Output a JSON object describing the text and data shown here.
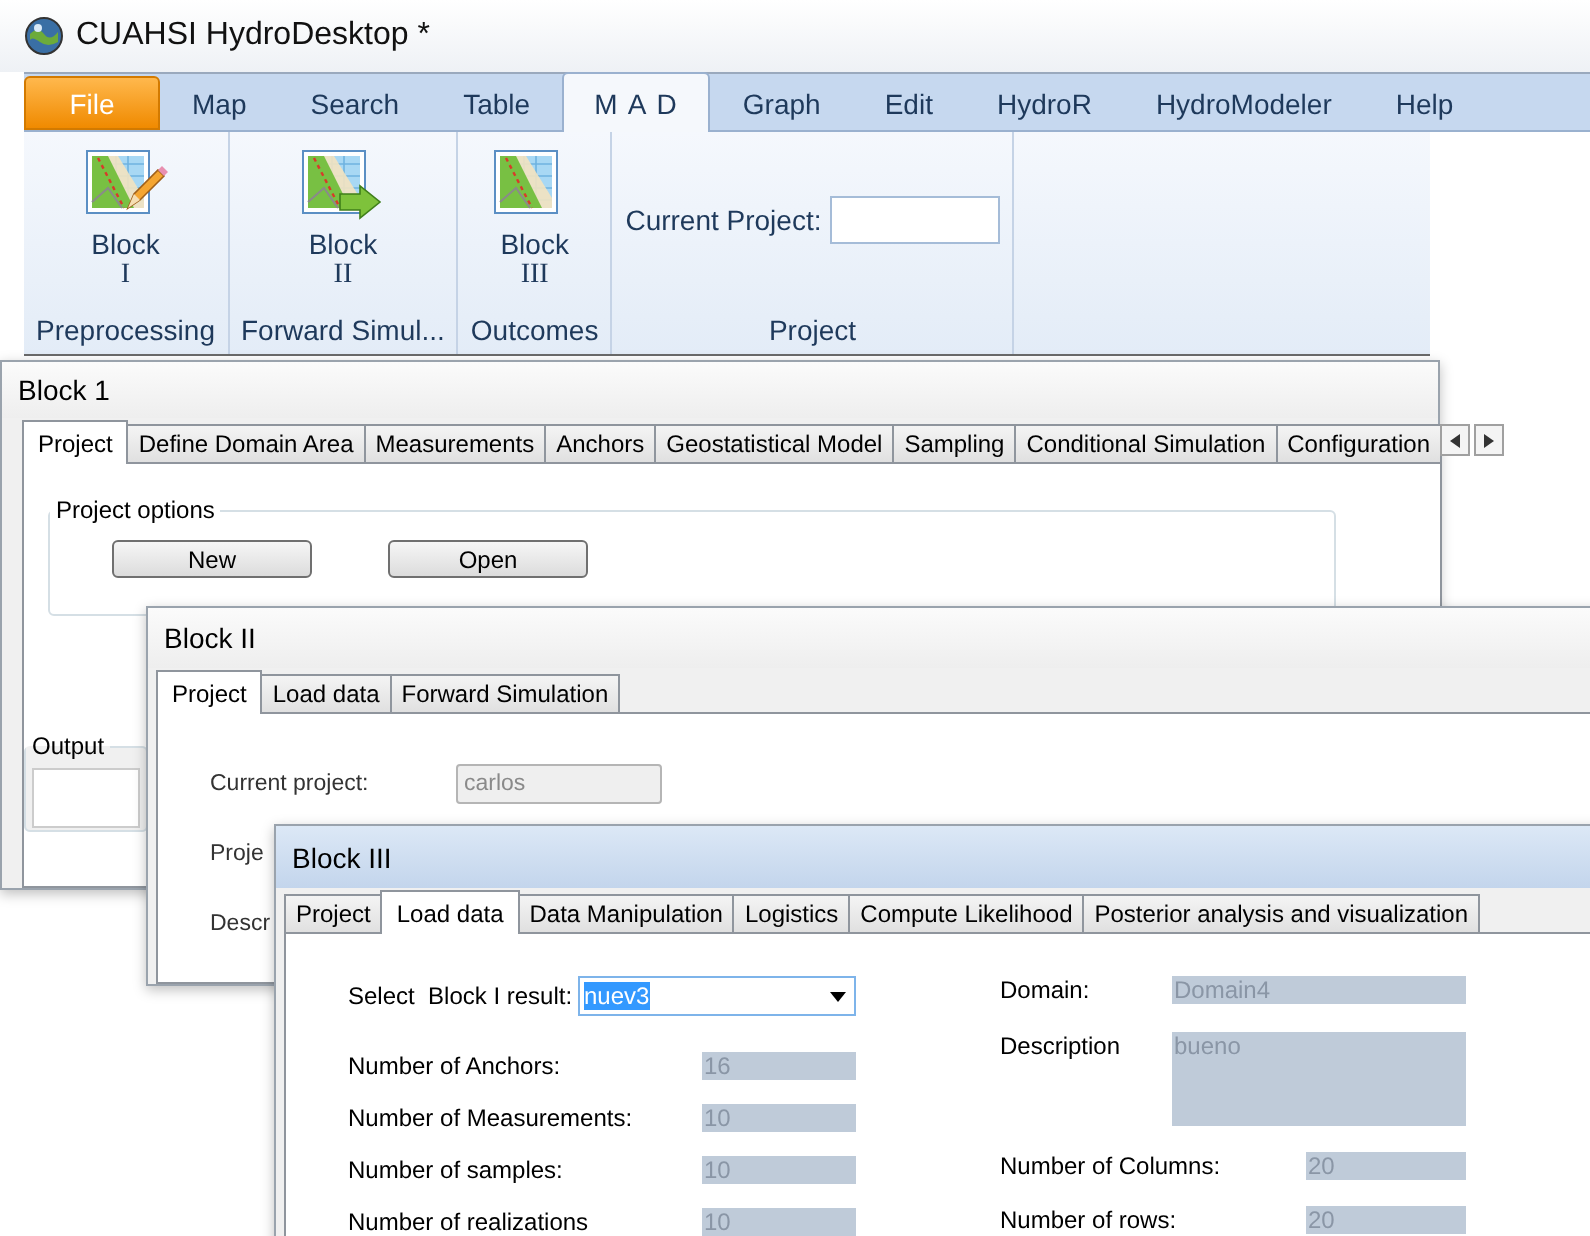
{
  "app": {
    "title": "CUAHSI HydroDesktop *"
  },
  "ribbon": {
    "tabs": [
      {
        "label": "File",
        "kind": "file",
        "selected": false
      },
      {
        "label": "Map",
        "kind": "tab",
        "selected": false
      },
      {
        "label": "Search",
        "kind": "tab",
        "selected": false
      },
      {
        "label": "Table",
        "kind": "tab",
        "selected": false
      },
      {
        "label": "M A D",
        "kind": "tab",
        "selected": true
      },
      {
        "label": "Graph",
        "kind": "tab",
        "selected": false
      },
      {
        "label": "Edit",
        "kind": "tab",
        "selected": false
      },
      {
        "label": "HydroR",
        "kind": "tab",
        "selected": false
      },
      {
        "label": "HydroModeler",
        "kind": "tab",
        "selected": false
      },
      {
        "label": "Help",
        "kind": "tab",
        "selected": false
      }
    ],
    "groups": [
      {
        "label": "Preprocessing",
        "kind": "buttons",
        "buttons": [
          {
            "label": "Block",
            "numeral": "I",
            "kind": "pencil"
          }
        ]
      },
      {
        "label": "Forward Simul...",
        "kind": "buttons",
        "buttons": [
          {
            "label": "Block",
            "numeral": "II",
            "kind": "arrow"
          }
        ]
      },
      {
        "label": "Outcomes",
        "kind": "buttons",
        "buttons": [
          {
            "label": "Block",
            "numeral": "III",
            "kind": "plain"
          }
        ]
      },
      {
        "label": "Project",
        "kind": "field",
        "field": {
          "label": "Current Project:"
        }
      }
    ]
  },
  "windows": [
    {
      "title": "Block 1",
      "active": false,
      "tabs": [
        {
          "label": "Project",
          "selected": true
        },
        {
          "label": "Define Domain Area",
          "selected": false
        },
        {
          "label": "Measurements",
          "selected": false
        },
        {
          "label": "Anchors",
          "selected": false
        },
        {
          "label": "Geostatistical Model",
          "selected": false
        },
        {
          "label": "Sampling",
          "selected": false
        },
        {
          "label": "Conditional Simulation",
          "selected": false
        },
        {
          "label": "Configuration",
          "selected": false
        }
      ],
      "content": {
        "kind": "project_options",
        "group": "Project options",
        "buttons": [
          "New",
          "Open"
        ],
        "output": "Output"
      }
    },
    {
      "title": "Block II",
      "active": false,
      "tabs": [
        {
          "label": "Project",
          "selected": true
        },
        {
          "label": "Load data",
          "selected": false
        },
        {
          "label": "Forward Simulation",
          "selected": false
        }
      ],
      "content": {
        "kind": "project",
        "fields": [
          {
            "label": "Current project:",
            "value": "carlos"
          },
          {
            "label": "Proje"
          },
          {
            "label": "Descr"
          }
        ]
      }
    },
    {
      "title": "Block III",
      "active": true,
      "tabs": [
        {
          "label": "Project",
          "selected": false
        },
        {
          "label": "Load data",
          "selected": true
        },
        {
          "label": "Data Manipulation",
          "selected": false
        },
        {
          "label": "Logistics",
          "selected": false
        },
        {
          "label": "Compute Likelihood",
          "selected": false
        },
        {
          "label": "Posterior analysis and visualization",
          "selected": false
        }
      ],
      "content": {
        "kind": "load_data",
        "select": {
          "label": "Select  Block I result:",
          "value": "nuev3",
          "highlighted": true
        },
        "left": [
          {
            "label": "Number of Anchors:",
            "value": "16"
          },
          {
            "label": "Number of Measurements:",
            "value": "10"
          },
          {
            "label": "Number of samples:",
            "value": "10"
          },
          {
            "label": "Number of realizations",
            "value": "10"
          }
        ],
        "right": [
          {
            "label": "Domain:",
            "value": "Domain4",
            "kind": "wide"
          },
          {
            "label": "Description",
            "value": "bueno",
            "kind": "multiline"
          },
          {
            "label": "Number of Columns:",
            "value": "20",
            "kind": "short"
          },
          {
            "label": "Number of rows:",
            "value": "20",
            "kind": "short"
          }
        ]
      }
    }
  ]
}
